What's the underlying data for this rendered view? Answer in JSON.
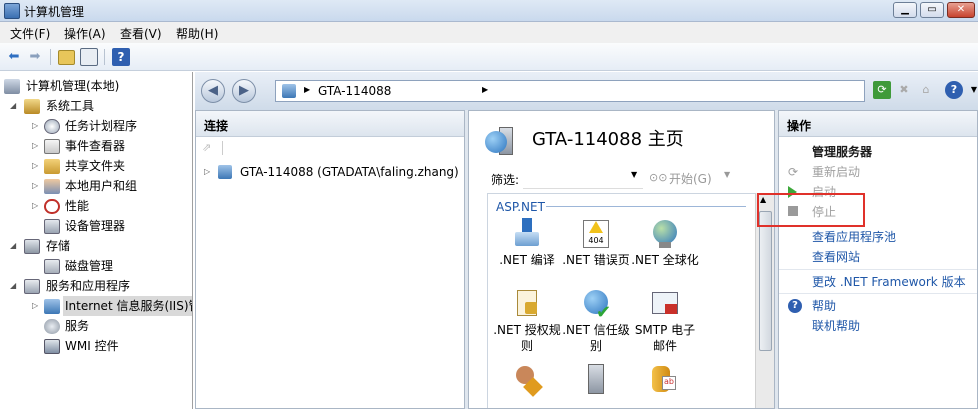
{
  "window": {
    "title": "计算机管理"
  },
  "menu": {
    "items": [
      "文件(F)",
      "操作(A)",
      "查看(V)",
      "帮助(H)"
    ]
  },
  "tree": {
    "root": "计算机管理(本地)",
    "system_tools": "系统工具",
    "task_scheduler": "任务计划程序",
    "event_viewer": "事件查看器",
    "shared_folders": "共享文件夹",
    "local_users": "本地用户和组",
    "performance": "性能",
    "device_manager": "设备管理器",
    "storage": "存储",
    "disk_management": "磁盘管理",
    "services_apps": "服务和应用程序",
    "iis": "Internet 信息服务(IIS)管",
    "services": "服务",
    "wmi": "WMI 控件"
  },
  "address": {
    "path": "GTA-114088"
  },
  "connections": {
    "header": "连接",
    "node": "GTA-114088 (GTADATA\\faling.zhang)"
  },
  "home": {
    "title": "GTA-114088 主页",
    "filter_label": "筛选:",
    "start_label": "开始(G)",
    "section": "ASP.NET",
    "features": [
      {
        "label": ".NET 编译",
        "icon": "net-compile-icon"
      },
      {
        "label": ".NET 错误页",
        "icon": "net-error-pages-icon"
      },
      {
        "label": ".NET 全球化",
        "icon": "net-globalization-icon"
      },
      {
        "label": ".NET 授权规则",
        "icon": "net-authorization-icon"
      },
      {
        "label": ".NET 信任级别",
        "icon": "net-trust-levels-icon"
      },
      {
        "label": "SMTP 电子邮件",
        "icon": "smtp-email-icon"
      }
    ]
  },
  "actions": {
    "header": "操作",
    "manage_server": "管理服务器",
    "restart": "重新启动",
    "start": "启动",
    "stop": "停止",
    "view_app_pools": "查看应用程序池",
    "view_sites": "查看网站",
    "change_framework": "更改 .NET Framework 版本",
    "help": "帮助",
    "online_help": "联机帮助"
  },
  "colors": {
    "link": "#1f57a8",
    "highlight_box": "#e0312a",
    "disabled": "#a0a0a0"
  }
}
